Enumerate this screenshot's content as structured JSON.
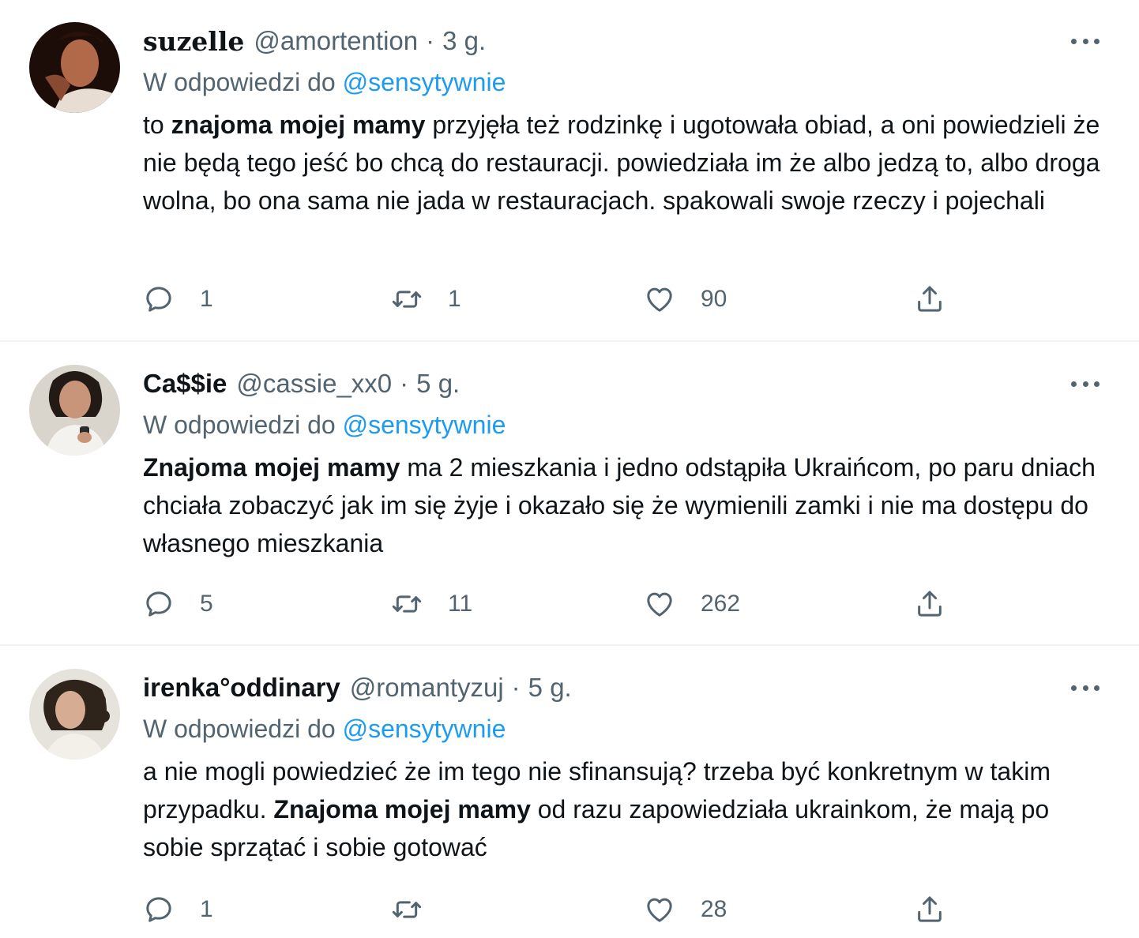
{
  "tweets": [
    {
      "display_name": "suzelle",
      "handle": "@amortention",
      "separator": "·",
      "time": "3 g.",
      "reply_prefix": "W odpowiedzi do",
      "reply_mention": "@sensytywnie",
      "body_parts": [
        {
          "text": "to ",
          "bold": false
        },
        {
          "text": "znajoma mojej mamy",
          "bold": true
        },
        {
          "text": " przyjęła też rodzinkę i ugotowała obiad, a oni powiedzieli że nie będą tego jeść bo chcą do restauracji. powiedziała im że albo jedzą to, albo droga wolna, bo ona sama nie jada w restauracjach. spakowali swoje rzeczy i pojechali",
          "bold": false
        }
      ],
      "counts": {
        "reply": "1",
        "retweet": "1",
        "like": "90"
      }
    },
    {
      "display_name": "Ca$$ie",
      "handle": "@cassie_xx0",
      "separator": "·",
      "time": "5 g.",
      "reply_prefix": "W odpowiedzi do",
      "reply_mention": "@sensytywnie",
      "body_parts": [
        {
          "text": "Znajoma mojej mamy",
          "bold": true
        },
        {
          "text": " ma 2 mieszkania i jedno odstąpiła Ukraińcom, po paru dniach chciała zobaczyć jak im się żyje i okazało się że wymienili zamki i nie ma dostępu do własnego mieszkania",
          "bold": false
        }
      ],
      "counts": {
        "reply": "5",
        "retweet": "11",
        "like": "262"
      }
    },
    {
      "display_name": "irenka°oddinary",
      "handle": "@romantyzuj",
      "separator": "·",
      "time": "5 g.",
      "reply_prefix": "W odpowiedzi do",
      "reply_mention": "@sensytywnie",
      "body_parts": [
        {
          "text": "a nie mogli powiedzieć że im tego nie sfinansują? trzeba być konkretnym w takim przypadku. ",
          "bold": false
        },
        {
          "text": "Znajoma mojej mamy",
          "bold": true
        },
        {
          "text": " od razu zapowiedziała ukrainkom, że mają po sobie sprzątać i sobie gotować",
          "bold": false
        }
      ],
      "counts": {
        "reply": "1",
        "retweet": "",
        "like": "28"
      }
    }
  ],
  "icons": {
    "reply": "speech-bubble-icon",
    "retweet": "retweet-arrows-icon",
    "like": "heart-outline-icon",
    "share": "share-upload-icon",
    "more": "more-dots-icon"
  },
  "colors": {
    "text": "#0f1419",
    "secondary": "#536471",
    "mention": "#1d9bf0",
    "divider": "#eff3f4"
  }
}
